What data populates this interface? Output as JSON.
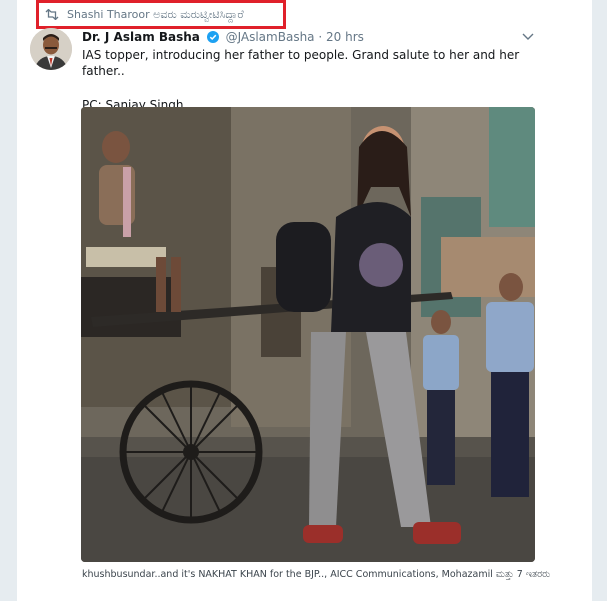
{
  "retweet": {
    "text": "Shashi Tharoor ಅವರು ಮರುಟ್ವೀಟಿಸಿದ್ದಾರೆ",
    "icon": "retweet-icon",
    "highlight_color": "#e0202a"
  },
  "tweet": {
    "author_name": "Dr. J Aslam Basha",
    "verified_icon": "verified-badge-icon",
    "handle": "@JAslamBasha",
    "separator": "·",
    "time": "20 hrs",
    "text": "IAS topper, introducing her father to people. Grand salute to her and her father..",
    "credit": "PC: Sanjay Singh",
    "menu_icon": "chevron-down-icon"
  },
  "photo": {
    "alt": "Photo"
  },
  "reply_context": {
    "text": "khushbusundar..and it's NAKHAT KHAN for the BJP.., AICC Communications, Mohazamil ಮತ್ತು 7 ಇತರರು"
  },
  "colors": {
    "background": "#e6ecf0",
    "card": "#ffffff",
    "verified": "#1da1f2",
    "secondary_text": "#657786"
  }
}
